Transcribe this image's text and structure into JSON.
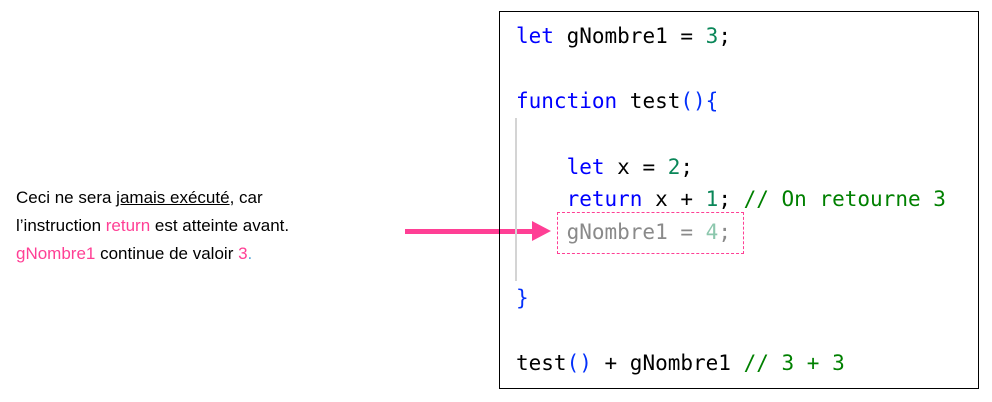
{
  "note": {
    "line1_a": "Ceci ne sera ",
    "line1_u": "jamais exécuté",
    "line1_b": ", car",
    "line2_a": "l’instruction ",
    "line2_kw": "return",
    "line2_b": " est atteinte avant.",
    "line3_var": "gNombre1",
    "line3_a": " continue de valoir ",
    "line3_num": "3",
    "line3_dot": "."
  },
  "code": {
    "l1": {
      "kw": "let",
      "a": " gNombre1 = ",
      "num": "3",
      "b": ";"
    },
    "l3": {
      "kw": "function",
      "a": " test",
      "paren": "()",
      "brace": "{"
    },
    "l5": {
      "indent": "    ",
      "kw": "let",
      "a": " x = ",
      "num": "2",
      "b": ";"
    },
    "l6": {
      "indent": "    ",
      "kw": "return",
      "a": " x + ",
      "num": "1",
      "b": "; ",
      "comment": "// On retourne 3"
    },
    "l7": {
      "indent": "    ",
      "a": "gNombre1 = ",
      "num": "4",
      "b": ";"
    },
    "l9": {
      "brace": "}"
    },
    "l11": {
      "a": "test",
      "paren": "()",
      "b": " + gNombre1 ",
      "comment": "// 3 + 3"
    }
  },
  "colors": {
    "accent": "#ff3f95",
    "keyword": "#0000ff",
    "number": "#098658",
    "comment": "#008000"
  }
}
